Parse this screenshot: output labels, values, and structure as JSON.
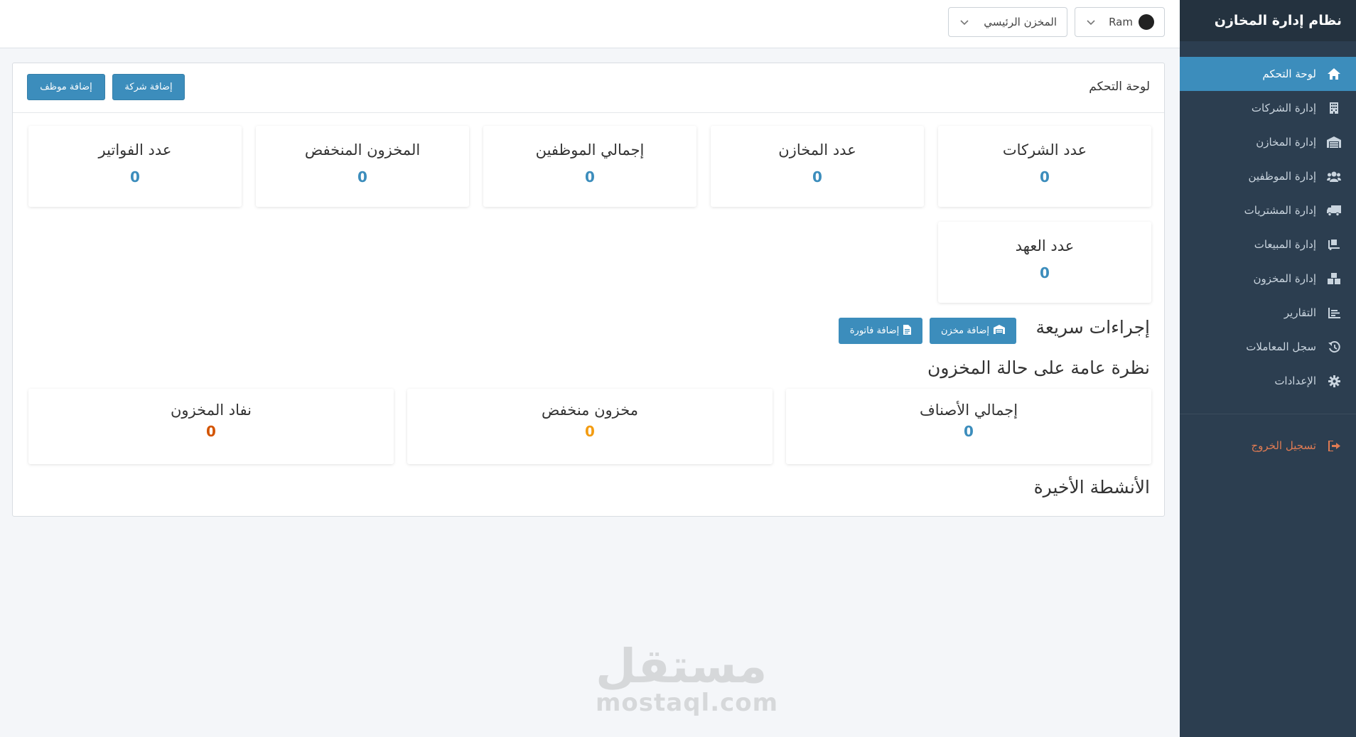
{
  "app": {
    "title": "نظام إدارة المخازن"
  },
  "sidebar": {
    "items": [
      {
        "label": "لوحة التحكم",
        "icon": "home-icon",
        "active": true
      },
      {
        "label": "إدارة الشركات",
        "icon": "building-icon"
      },
      {
        "label": "إدارة المخازن",
        "icon": "warehouse-icon"
      },
      {
        "label": "إدارة الموظفين",
        "icon": "users-icon"
      },
      {
        "label": "إدارة المشتريات",
        "icon": "truck-icon"
      },
      {
        "label": "إدارة المبيعات",
        "icon": "dolly-icon"
      },
      {
        "label": "إدارة المخزون",
        "icon": "boxes-icon"
      },
      {
        "label": "التقارير",
        "icon": "chart-icon"
      },
      {
        "label": "سجل المعاملات",
        "icon": "history-icon"
      },
      {
        "label": "الإعدادات",
        "icon": "gear-icon"
      }
    ],
    "logout": {
      "label": "تسجيل الخروج",
      "icon": "sign-out-icon"
    }
  },
  "topbar": {
    "user": {
      "name": "Ram",
      "icon": "avatar"
    },
    "store_select": {
      "value": "المخزن الرئيسي"
    }
  },
  "dashboard": {
    "title": "لوحة التحكم",
    "add_company_label": "إضافة شركة",
    "add_employee_label": "إضافة موظف",
    "stats": [
      {
        "label": "عدد الشركات",
        "value": "0"
      },
      {
        "label": "عدد المخازن",
        "value": "0"
      },
      {
        "label": "إجمالي الموظفين",
        "value": "0"
      },
      {
        "label": "المخزون المنخفض",
        "value": "0"
      },
      {
        "label": "عدد الفواتير",
        "value": "0"
      },
      {
        "label": "عدد العهد",
        "value": "0"
      }
    ],
    "quick_actions": {
      "title": "إجراءات سريعة",
      "add_warehouse_label": "إضافة مخزن",
      "add_invoice_label": "إضافة فاتورة"
    },
    "overview": {
      "title": "نظرة عامة على حالة المخزون",
      "cards": [
        {
          "label": "إجمالي الأصناف",
          "value": "0",
          "color": "#3c8dbc"
        },
        {
          "label": "مخزون منخفض",
          "value": "0",
          "color": "#f39c12"
        },
        {
          "label": "نفاد المخزون",
          "value": "0",
          "color": "#d35400"
        }
      ]
    },
    "recent_title": "الأنشطة الأخيرة"
  },
  "watermark": {
    "arabic": "مستقل",
    "latin": "mostaql.com"
  },
  "colors": {
    "sidebar": "#2c3e50",
    "accent": "#3c8dbc",
    "warning": "#f39c12",
    "danger": "#d35400",
    "logout": "#e07b53"
  }
}
